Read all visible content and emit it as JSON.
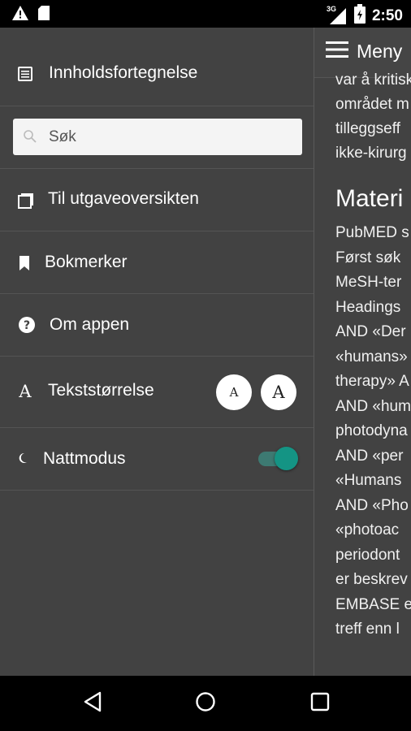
{
  "status_bar": {
    "time": "2:50",
    "network_label": "3G",
    "icons": [
      "warning-icon",
      "sd-card-icon",
      "signal-icon",
      "battery-icon"
    ]
  },
  "appbar": {
    "menu_label": "Meny"
  },
  "article": {
    "intro_lines": [
      "var å kritisk",
      "området m",
      "tilleggseff",
      "ikke-kirurg"
    ],
    "heading": "Materi",
    "body_lines": [
      "PubMED s",
      "Først søk",
      "MeSH-ter",
      "Headings",
      "AND «Der",
      "«humans»",
      "therapy» A",
      "AND «hum",
      "photodyna",
      "AND «per",
      "«Humans",
      "AND «Pho",
      "«photoac",
      "periodont",
      "er beskrev",
      "EMBASE e",
      "treff enn l"
    ]
  },
  "drawer": {
    "items": [
      {
        "label": "Innholdsfortegnelse",
        "icon": "list-icon"
      },
      {
        "label": "Til utgaveoversikten",
        "icon": "issues-icon"
      },
      {
        "label": "Bokmerker",
        "icon": "bookmark-icon"
      },
      {
        "label": "Om appen",
        "icon": "help-icon"
      },
      {
        "label": "Tekststørrelse",
        "icon": "text-size-icon"
      },
      {
        "label": "Nattmodus",
        "icon": "moon-icon"
      }
    ],
    "search": {
      "placeholder": "Søk",
      "value": ""
    },
    "font_buttons": {
      "small": "A",
      "large": "A"
    },
    "night_mode": {
      "enabled": true
    }
  },
  "colors": {
    "drawer_bg": "#424242",
    "accent": "#149484",
    "divider": "#545454"
  },
  "nav_bar": {
    "buttons": [
      "back-icon",
      "home-icon",
      "recents-icon"
    ]
  }
}
